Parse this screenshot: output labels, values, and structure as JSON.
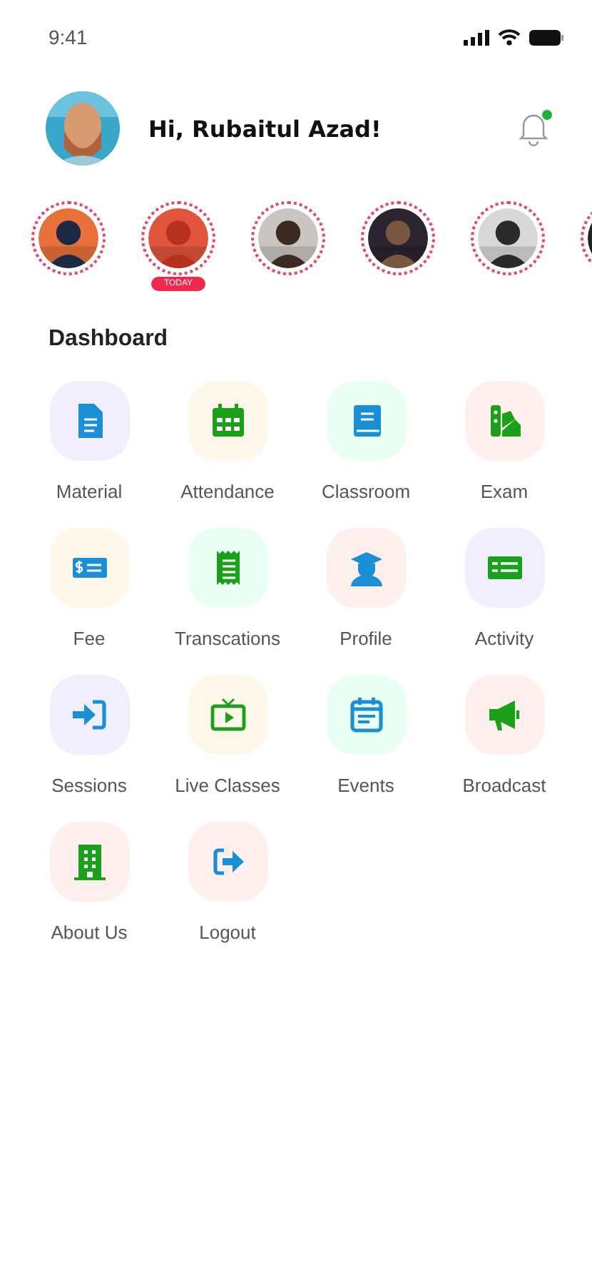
{
  "status_bar": {
    "time": "9:41"
  },
  "header": {
    "greeting": "Hi, Rubaitul Azad!",
    "notifications": {
      "unread": true
    }
  },
  "stories": [
    {
      "kind": "picture"
    },
    {
      "kind": "picture",
      "badge": "TODAY"
    },
    {
      "kind": "picture"
    },
    {
      "kind": "picture"
    },
    {
      "kind": "picture"
    },
    {
      "kind": "picture"
    }
  ],
  "dashboard": {
    "title": "Dashboard",
    "items": [
      {
        "label": "Material",
        "kind": "document",
        "color": "#f1efff"
      },
      {
        "label": "Attendance",
        "kind": "calendar",
        "color": "#fff8ea"
      },
      {
        "label": "Classroom",
        "kind": "book",
        "color": "#eafff3"
      },
      {
        "label": "Exam",
        "kind": "swatch",
        "color": "#fff0ee"
      },
      {
        "label": "Fee",
        "kind": "cheque",
        "color": "#fff8ea"
      },
      {
        "label": "Transcations",
        "kind": "receipt",
        "color": "#eafff3"
      },
      {
        "label": "Profile",
        "kind": "graduate",
        "color": "#fff0ee"
      },
      {
        "label": "Activity",
        "kind": "list",
        "color": "#f1efff"
      },
      {
        "label": "Sessions",
        "kind": "login",
        "color": "#f1efff"
      },
      {
        "label": "Live Classes",
        "kind": "tv",
        "color": "#fff8ea"
      },
      {
        "label": "Events",
        "kind": "event",
        "color": "#eafff3"
      },
      {
        "label": "Broadcast",
        "kind": "megaphone",
        "color": "#fff0ee"
      },
      {
        "label": "About Us",
        "kind": "building",
        "color": "#fff0ee"
      },
      {
        "label": "Logout",
        "kind": "logout",
        "color": "#fff0ee"
      }
    ]
  }
}
